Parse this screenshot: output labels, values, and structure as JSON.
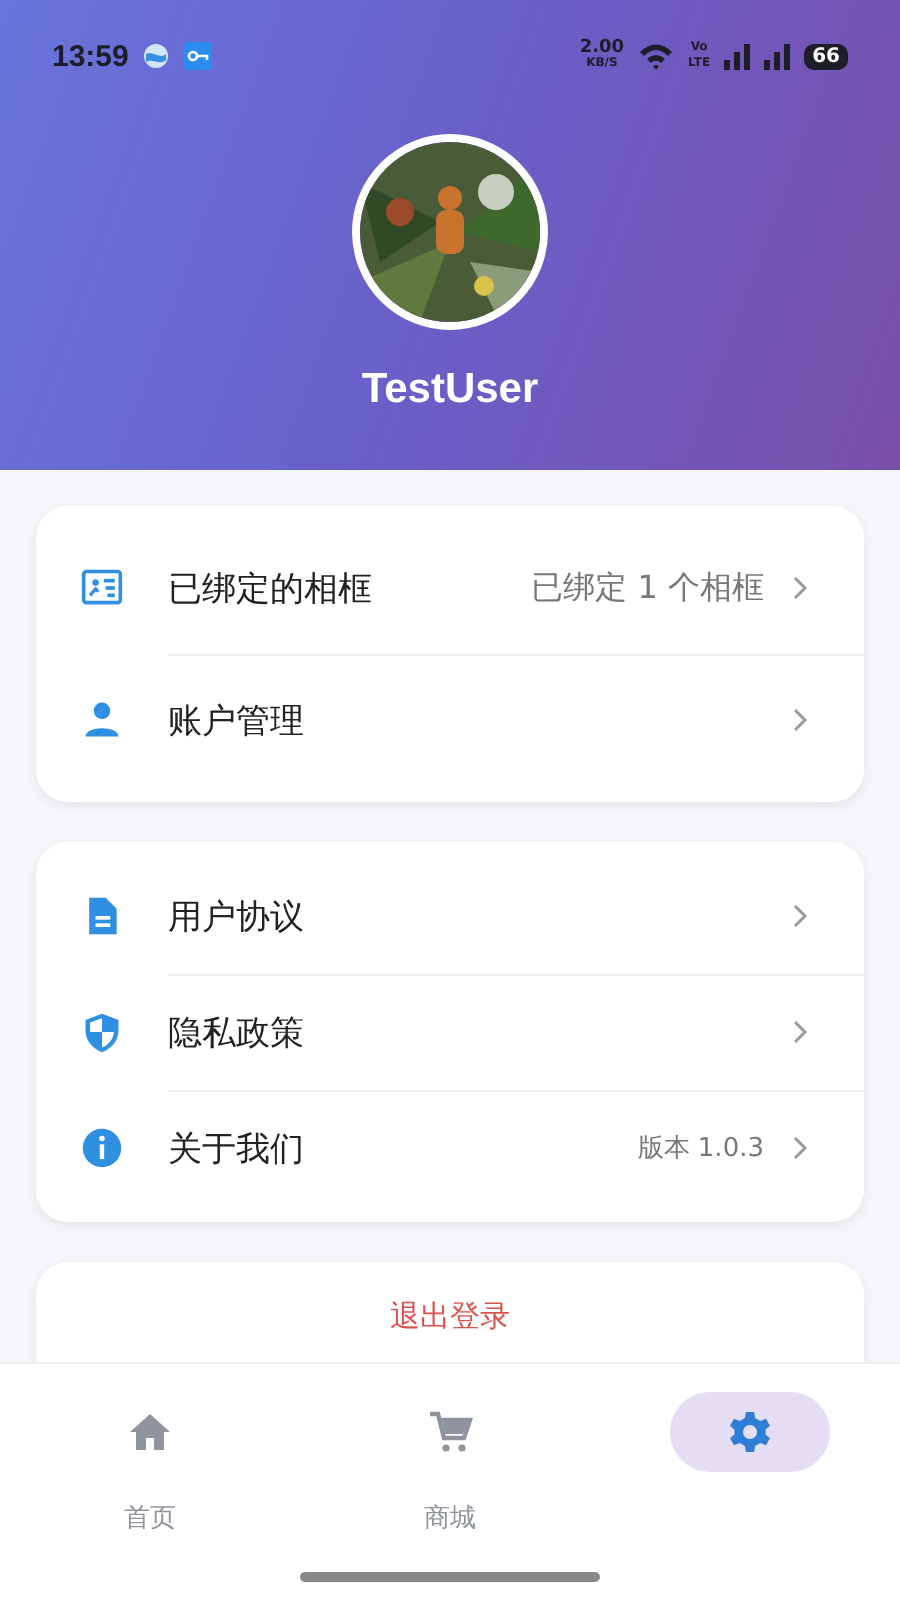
{
  "status_bar": {
    "time": "13:59",
    "speed": "2.00",
    "speed_unit": "KB/S",
    "network": "Vo",
    "network_sub": "LTE",
    "battery": "66"
  },
  "profile": {
    "name": "TestUser"
  },
  "sections": [
    {
      "items": [
        {
          "kind": "id-card",
          "label": "已绑定的相框",
          "value": "已绑定 1 个相框"
        },
        {
          "kind": "person",
          "label": "账户管理"
        }
      ]
    },
    {
      "items": [
        {
          "kind": "document",
          "label": "用户协议"
        },
        {
          "kind": "shield",
          "label": "隐私政策"
        },
        {
          "kind": "info",
          "label": "关于我们",
          "value": "版本 1.0.3"
        }
      ]
    }
  ],
  "logout": {
    "label": "退出登录"
  },
  "tabs": [
    {
      "kind": "home",
      "label": "首页",
      "selected": false
    },
    {
      "kind": "cart",
      "label": "商城",
      "selected": false
    },
    {
      "kind": "settings",
      "selected": true
    }
  ]
}
